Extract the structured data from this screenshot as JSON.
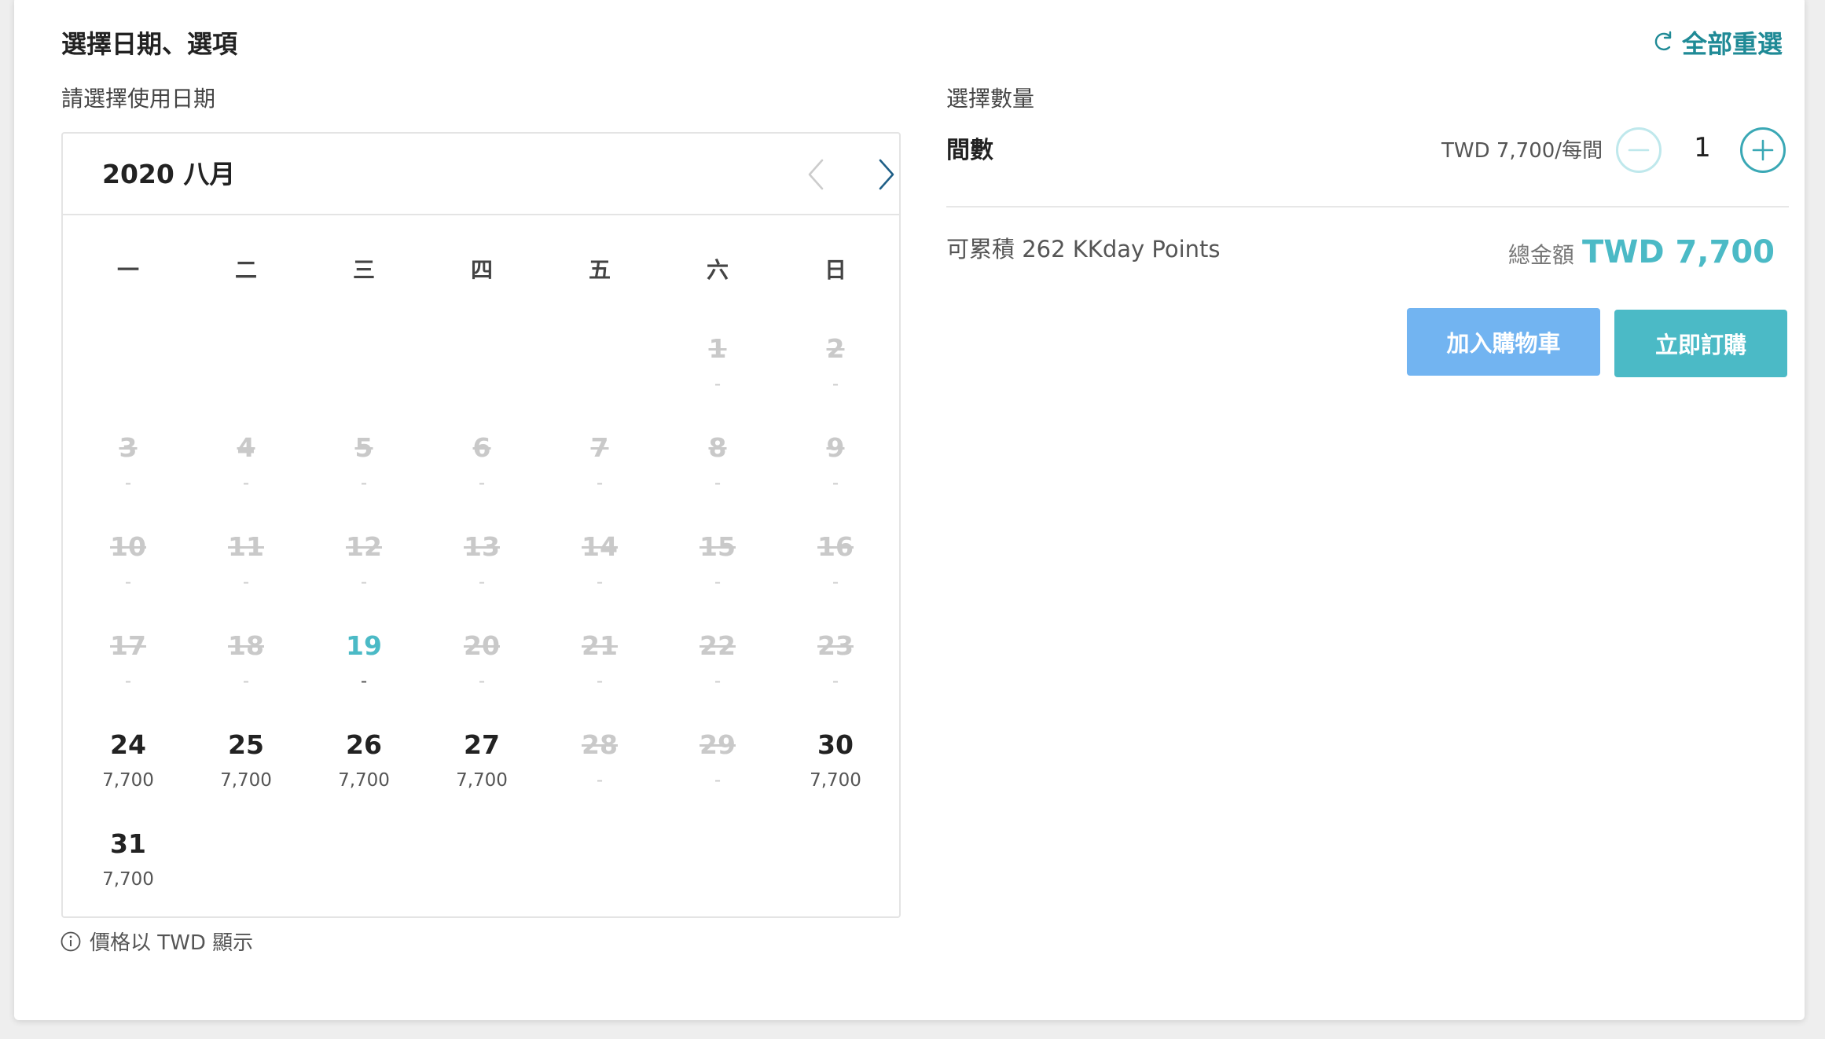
{
  "header": {
    "title": "選擇日期、選項",
    "reset_label": "全部重選"
  },
  "date_section": {
    "label": "請選擇使用日期",
    "month_label": "2020 八月",
    "weekdays": [
      "一",
      "二",
      "三",
      "四",
      "五",
      "六",
      "日"
    ],
    "leading_blank_days": 5,
    "days": [
      {
        "day": "1",
        "price": "-",
        "status": "disabled"
      },
      {
        "day": "2",
        "price": "-",
        "status": "disabled"
      },
      {
        "day": "3",
        "price": "-",
        "status": "disabled"
      },
      {
        "day": "4",
        "price": "-",
        "status": "disabled"
      },
      {
        "day": "5",
        "price": "-",
        "status": "disabled"
      },
      {
        "day": "6",
        "price": "-",
        "status": "disabled"
      },
      {
        "day": "7",
        "price": "-",
        "status": "disabled"
      },
      {
        "day": "8",
        "price": "-",
        "status": "disabled"
      },
      {
        "day": "9",
        "price": "-",
        "status": "disabled"
      },
      {
        "day": "10",
        "price": "-",
        "status": "disabled"
      },
      {
        "day": "11",
        "price": "-",
        "status": "disabled"
      },
      {
        "day": "12",
        "price": "-",
        "status": "disabled"
      },
      {
        "day": "13",
        "price": "-",
        "status": "disabled"
      },
      {
        "day": "14",
        "price": "-",
        "status": "disabled"
      },
      {
        "day": "15",
        "price": "-",
        "status": "disabled"
      },
      {
        "day": "16",
        "price": "-",
        "status": "disabled"
      },
      {
        "day": "17",
        "price": "-",
        "status": "disabled"
      },
      {
        "day": "18",
        "price": "-",
        "status": "disabled"
      },
      {
        "day": "19",
        "price": "-",
        "status": "today"
      },
      {
        "day": "20",
        "price": "-",
        "status": "disabled"
      },
      {
        "day": "21",
        "price": "-",
        "status": "disabled"
      },
      {
        "day": "22",
        "price": "-",
        "status": "disabled"
      },
      {
        "day": "23",
        "price": "-",
        "status": "disabled"
      },
      {
        "day": "24",
        "price": "7,700",
        "status": "available"
      },
      {
        "day": "25",
        "price": "7,700",
        "status": "available"
      },
      {
        "day": "26",
        "price": "7,700",
        "status": "available"
      },
      {
        "day": "27",
        "price": "7,700",
        "status": "available"
      },
      {
        "day": "28",
        "price": "-",
        "status": "disabled"
      },
      {
        "day": "29",
        "price": "-",
        "status": "disabled"
      },
      {
        "day": "30",
        "price": "7,700",
        "status": "available"
      },
      {
        "day": "31",
        "price": "7,700",
        "status": "available"
      }
    ],
    "currency_note": "價格以 TWD 顯示"
  },
  "quantity_section": {
    "label": "選擇數量",
    "item_label": "間數",
    "unit_price": "TWD 7,700/每間",
    "quantity": "1",
    "points_text": "可累積 262 KKday Points",
    "total_label": "總金額",
    "total_value": "TWD 7,700"
  },
  "actions": {
    "add_to_cart": "加入購物車",
    "book_now": "立即訂購"
  },
  "icons": {
    "reset": "refresh-icon",
    "prev": "chevron-left-icon",
    "next": "chevron-right-icon",
    "minus": "minus-circle-icon",
    "plus": "plus-circle-icon",
    "info": "info-icon"
  },
  "colors": {
    "accent_teal": "#4bbac6",
    "reset_teal": "#1f8a96",
    "cart_blue": "#72b4f1",
    "disabled_text": "#c9c9c9"
  }
}
